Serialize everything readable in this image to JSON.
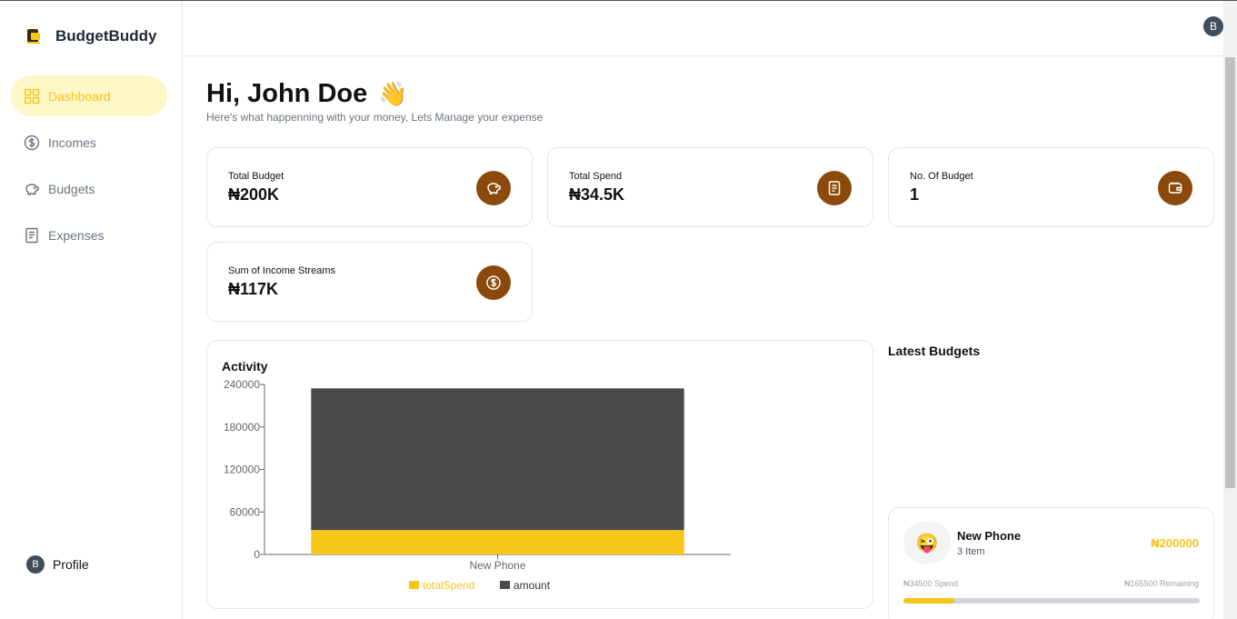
{
  "app": {
    "name": "BudgetBuddy"
  },
  "sidebar": {
    "items": [
      {
        "label": "Dashboard",
        "icon": "grid-icon",
        "active": true
      },
      {
        "label": "Incomes",
        "icon": "dollar-circle-icon",
        "active": false
      },
      {
        "label": "Budgets",
        "icon": "piggy-bank-icon",
        "active": false
      },
      {
        "label": "Expenses",
        "icon": "receipt-icon",
        "active": false
      }
    ],
    "profile": {
      "initial": "B",
      "label": "Profile"
    }
  },
  "topbar": {
    "avatar_initial": "B"
  },
  "greeting": {
    "title": "Hi, John Doe",
    "emoji": "👋",
    "subtitle": "Here's what happenning with your money, Lets Manage your expense"
  },
  "stats": [
    {
      "label": "Total Budget",
      "value": "₦200K",
      "icon": "piggy-bank-icon"
    },
    {
      "label": "Total Spend",
      "value": "₦34.5K",
      "icon": "receipt-icon"
    },
    {
      "label": "No. Of Budget",
      "value": "1",
      "icon": "wallet-icon"
    },
    {
      "label": "Sum of Income Streams",
      "value": "₦117K",
      "icon": "dollar-circle-icon"
    }
  ],
  "activity": {
    "title": "Activity"
  },
  "chart_data": {
    "type": "bar",
    "stacked": true,
    "categories": [
      "New Phone"
    ],
    "series": [
      {
        "name": "totalSpend",
        "values": [
          34500
        ],
        "color": "#f5c518"
      },
      {
        "name": "amount",
        "values": [
          200000
        ],
        "color": "#4a4a4c"
      }
    ],
    "yticks": [
      "0",
      "60000",
      "120000",
      "180000",
      "240000"
    ],
    "ylim": [
      0,
      240000
    ],
    "legend": "bottom"
  },
  "latest_budgets": {
    "title": "Latest Budgets",
    "items": [
      {
        "icon": "😜",
        "name": "New Phone",
        "items": "3 Item",
        "amount": "₦200000",
        "spend": "₦34500 Spend",
        "remaining": "₦165500 Remaining",
        "progress": 0.1725
      }
    ]
  },
  "colors": {
    "accent": "#f5c518",
    "brown": "#8b4a0b",
    "dark_bar": "#4a4a4c"
  }
}
